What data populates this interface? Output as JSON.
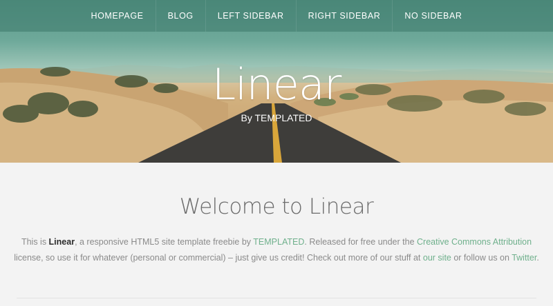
{
  "nav": {
    "items": [
      "Homepage",
      "Blog",
      "Left Sidebar",
      "Right Sidebar",
      "No Sidebar"
    ]
  },
  "hero": {
    "title": "Linear",
    "subtitle": "By TEMPLATED"
  },
  "welcome": {
    "heading": "Welcome to Linear",
    "text_1": "This is ",
    "brand": "Linear",
    "text_2": ", a responsive HTML5 site template freebie by ",
    "link_templated": "TEMPLATED",
    "text_3": ". Released for free under the ",
    "link_license": "Creative Commons Attribution",
    "text_4": " license, so use it for whatever (personal or commercial) – just give us credit! Check out more of our stuff at ",
    "link_site": "our site",
    "text_5": " or follow us on ",
    "link_twitter": "Twitter",
    "text_6": "."
  },
  "colors": {
    "accent": "#6fb08c",
    "nav_bg": "#3c7869",
    "page_bg": "#f3f3f3"
  }
}
